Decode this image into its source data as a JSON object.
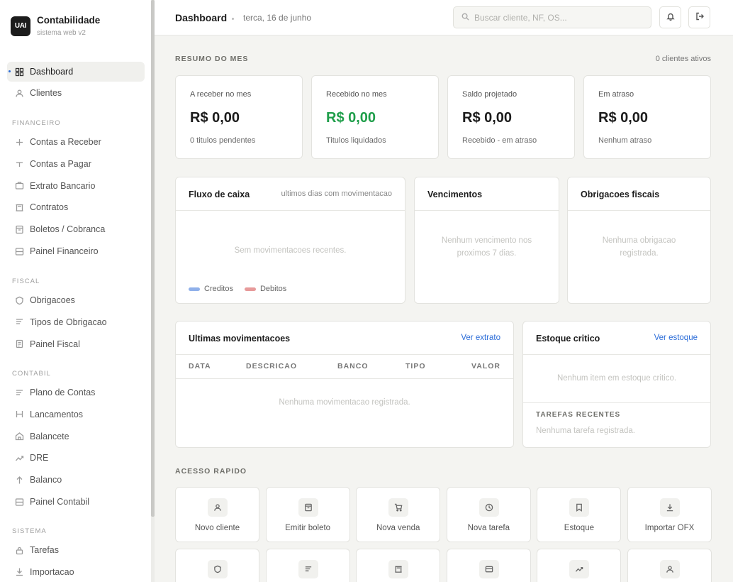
{
  "brand": {
    "logo_text": "UAI",
    "title": "Contabilidade",
    "subtitle": "sistema web v2"
  },
  "sidebar": {
    "items_top": [
      {
        "label": "Dashboard",
        "icon": "grid-icon",
        "active": true
      },
      {
        "label": "Clientes",
        "icon": "user-icon"
      }
    ],
    "sections": [
      {
        "title": "FINANCEIRO",
        "items": [
          {
            "label": "Contas a Receber",
            "icon": "plus-icon"
          },
          {
            "label": "Contas a Pagar",
            "icon": "minus-icon"
          },
          {
            "label": "Extrato Bancario",
            "icon": "briefcase-icon"
          },
          {
            "label": "Contratos",
            "icon": "columns-icon"
          },
          {
            "label": "Boletos / Cobranca",
            "icon": "receipt-icon"
          },
          {
            "label": "Painel Financeiro",
            "icon": "panel-icon"
          }
        ]
      },
      {
        "title": "FISCAL",
        "items": [
          {
            "label": "Obrigacoes",
            "icon": "shield-icon"
          },
          {
            "label": "Tipos de Obrigacao",
            "icon": "lines-icon"
          },
          {
            "label": "Painel Fiscal",
            "icon": "doc-icon"
          }
        ]
      },
      {
        "title": "CONTABIL",
        "items": [
          {
            "label": "Plano de Contas",
            "icon": "lines-icon"
          },
          {
            "label": "Lancamentos",
            "icon": "h-icon"
          },
          {
            "label": "Balancete",
            "icon": "home-icon"
          },
          {
            "label": "DRE",
            "icon": "trend-icon"
          },
          {
            "label": "Balanco",
            "icon": "arrow-up-icon"
          },
          {
            "label": "Painel Contabil",
            "icon": "panel-icon"
          }
        ]
      },
      {
        "title": "SISTEMA",
        "items": [
          {
            "label": "Tarefas",
            "icon": "lock-icon"
          },
          {
            "label": "Importacao",
            "icon": "download-icon"
          }
        ]
      }
    ]
  },
  "header": {
    "title": "Dashboard",
    "date": "terca, 16 de junho",
    "search_placeholder": "Buscar cliente, NF, OS..."
  },
  "summary": {
    "title": "RESUMO DO MES",
    "active_clients": "0 clientes ativos",
    "cards": [
      {
        "label": "A receber no mes",
        "value": "R$ 0,00",
        "sub": "0 titulos pendentes"
      },
      {
        "label": "Recebido no mes",
        "value": "R$ 0,00",
        "sub": "Titulos liquidados",
        "color": "#1f9e4a"
      },
      {
        "label": "Saldo projetado",
        "value": "R$ 0,00",
        "sub": "Recebido - em atraso"
      },
      {
        "label": "Em atraso",
        "value": "R$ 0,00",
        "sub": "Nenhum atraso"
      }
    ]
  },
  "cashflow": {
    "title": "Fluxo de caixa",
    "meta": "ultimos dias com movimentacao",
    "empty": "Sem movimentacoes recentes.",
    "legend": [
      {
        "label": "Creditos",
        "color": "#8fb0ea"
      },
      {
        "label": "Debitos",
        "color": "#e79a9a"
      }
    ]
  },
  "due": {
    "title": "Vencimentos",
    "empty_line1": "Nenhum vencimento nos",
    "empty_line2": "proximos 7 dias."
  },
  "tax": {
    "title": "Obrigacoes fiscais",
    "empty_line1": "Nenhuma obrigacao",
    "empty_line2": "registrada."
  },
  "movements": {
    "title": "Ultimas movimentacoes",
    "link": "Ver extrato",
    "columns": [
      "DATA",
      "DESCRICAO",
      "BANCO",
      "TIPO",
      "VALOR"
    ],
    "empty": "Nenhuma movimentacao registrada."
  },
  "stock": {
    "title": "Estoque critico",
    "link": "Ver estoque",
    "empty": "Nenhum item em estoque critico.",
    "tasks_title": "TAREFAS RECENTES",
    "tasks_empty": "Nenhuma tarefa registrada."
  },
  "quick_access": {
    "title": "ACESSO RAPIDO",
    "items": [
      {
        "label": "Novo cliente",
        "icon": "user-icon"
      },
      {
        "label": "Emitir boleto",
        "icon": "receipt-icon"
      },
      {
        "label": "Nova venda",
        "icon": "cart-icon"
      },
      {
        "label": "Nova tarefa",
        "icon": "clock-icon"
      },
      {
        "label": "Estoque",
        "icon": "bookmark-icon"
      },
      {
        "label": "Importar OFX",
        "icon": "download-icon"
      },
      {
        "label": "",
        "icon": "shield-icon"
      },
      {
        "label": "",
        "icon": "lines-icon"
      },
      {
        "label": "",
        "icon": "columns-icon"
      },
      {
        "label": "",
        "icon": "card-icon"
      },
      {
        "label": "",
        "icon": "trend-icon"
      },
      {
        "label": "",
        "icon": "user-icon"
      }
    ]
  }
}
